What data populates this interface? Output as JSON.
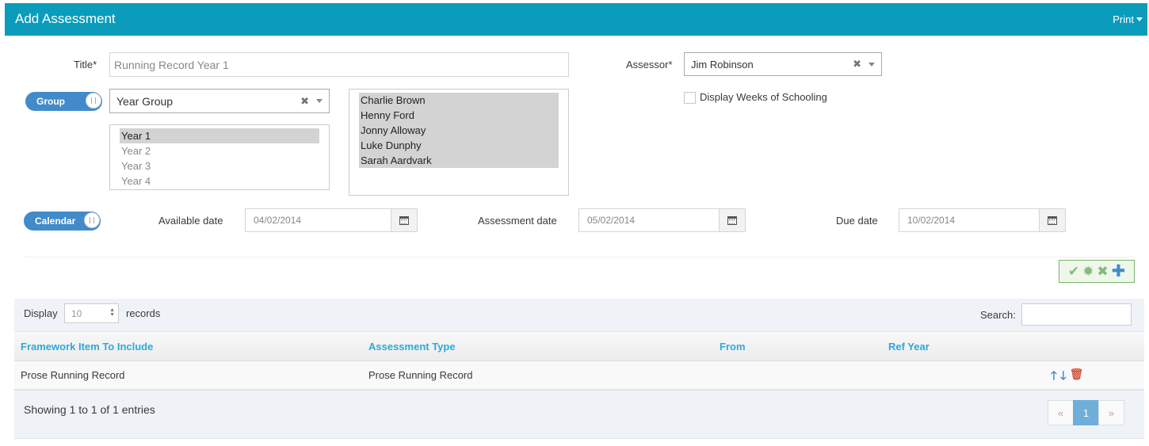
{
  "header": {
    "title": "Add Assessment",
    "print_label": "Print"
  },
  "form": {
    "title_label": "Title*",
    "title_placeholder": "Running Record Year 1",
    "assessor_label": "Assessor*",
    "assessor_value": "Jim Robinson",
    "group_toggle_label": "Group",
    "group_select_value": "Year Group",
    "years": [
      "Year 1",
      "Year 2",
      "Year 3",
      "Year 4"
    ],
    "selected_year": "Year 1",
    "students": [
      "Charlie Brown",
      "Henny Ford",
      "Jonny Alloway",
      "Luke Dunphy",
      "Sarah Aardvark"
    ],
    "display_weeks_label": "Display Weeks of Schooling",
    "calendar_toggle_label": "Calendar",
    "available_date_label": "Available date",
    "available_date": "04/02/2014",
    "assessment_date_label": "Assessment date",
    "assessment_date": "05/02/2014",
    "due_date_label": "Due date",
    "due_date": "10/02/2014"
  },
  "actions": {
    "icons": [
      "check-icon",
      "gear-icon",
      "close-icon",
      "plus-icon"
    ],
    "colors": {
      "check": "#87b87f",
      "gear": "#87b87f",
      "close": "#87b87f",
      "plus": "#428bca"
    }
  },
  "table": {
    "display_label": "Display",
    "records_label": "records",
    "length_value": "10",
    "search_label": "Search:",
    "columns": [
      "Framework Item To Include",
      "Assessment Type",
      "From",
      "Ref Year"
    ],
    "rows": [
      {
        "framework_item": "Prose Running Record",
        "assessment_type": "Prose Running Record",
        "from": "",
        "ref_year": ""
      }
    ],
    "info": "Showing 1 to 1 of 1 entries",
    "pager": {
      "prev": "«",
      "current": "1",
      "next": "»"
    }
  },
  "colors": {
    "header_bg": "#0b9cbc",
    "accent": "#428bca",
    "delete": "#d15b47"
  }
}
